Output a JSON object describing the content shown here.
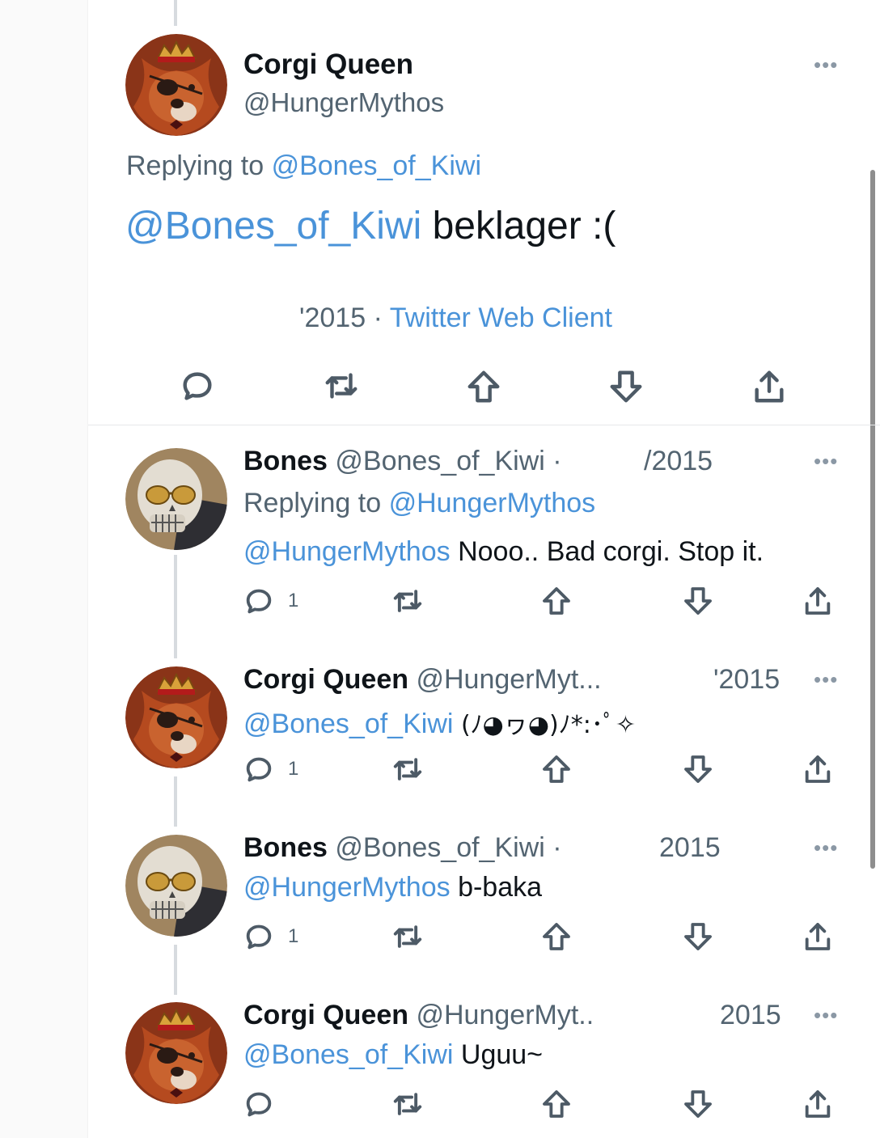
{
  "main_tweet": {
    "author_name": "Corgi Queen",
    "author_handle": "@HungerMythos",
    "replying_prefix": "Replying to",
    "replying_to": "@Bones_of_Kiwi",
    "mention": "@Bones_of_Kiwi",
    "text": " beklager :(",
    "date_fragment": "'2015",
    "separator": " · ",
    "client": "Twitter Web Client"
  },
  "replies": [
    {
      "author_name": "Bones",
      "author_handle": "@Bones_of_Kiwi ·",
      "date": "/2015",
      "replying_prefix": "Replying to",
      "replying_to": "@HungerMythos",
      "mention": "@HungerMythos",
      "text": " Nooo.. Bad corgi. Stop it.",
      "reply_count": "1"
    },
    {
      "author_name": "Corgi Queen",
      "author_handle": "@HungerMyt...",
      "date": "'2015",
      "mention": "@Bones_of_Kiwi",
      "text": " (ﾉ◕ヮ◕)ﾉ*:･ﾟ✧",
      "reply_count": "1"
    },
    {
      "author_name": "Bones",
      "author_handle": "@Bones_of_Kiwi ·",
      "date": "2015",
      "mention": "@HungerMythos",
      "text": " b-baka",
      "reply_count": "1"
    },
    {
      "author_name": "Corgi Queen",
      "author_handle": "@HungerMyt..",
      "date": "2015",
      "mention": "@Bones_of_Kiwi",
      "text": " Uguu~",
      "reply_count": ""
    }
  ],
  "icons": {
    "reply": "speech-bubble-icon",
    "retweet": "retweet-icon",
    "upvote": "arrow-up-icon",
    "downvote": "arrow-down-icon",
    "share": "share-icon",
    "more": "more-dots-icon"
  },
  "colors": {
    "link": "#4a93d9",
    "text": "#0f1419",
    "secondary": "#536471"
  }
}
